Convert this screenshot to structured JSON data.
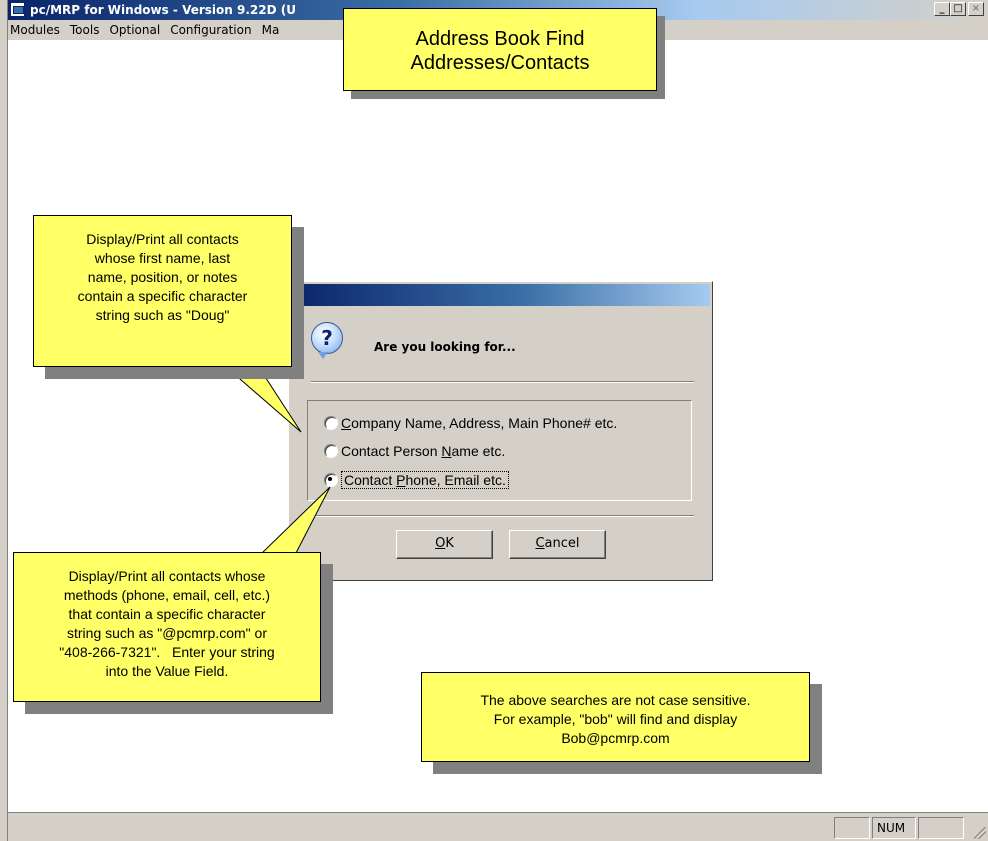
{
  "window": {
    "title": "pc/MRP for Windows - Version 9.22D (U",
    "minimize_glyph": "_",
    "maximize_glyph": "□",
    "close_glyph": "×"
  },
  "menubar": {
    "items": [
      "Modules",
      "Tools",
      "Optional",
      "Configuration",
      "Ma"
    ]
  },
  "callouts": {
    "title": [
      "Address Book Find",
      "Addresses/Contacts"
    ],
    "left": [
      "Display/Print all contacts",
      "whose first name, last",
      "name, position, or notes",
      "contain a specific character",
      "string such as \"Doug\""
    ],
    "bottom": [
      "Display/Print all contacts whose",
      "methods (phone, email, cell, etc.)",
      "that contain a specific character",
      "string such as \"@pcmrp.com\" or",
      "\"408-266-7321\".   Enter your string",
      "into the Value Field."
    ],
    "right": [
      "The above searches are not case sensitive.",
      "For example, \"bob\" will find and display",
      "Bob@pcmrp.com"
    ]
  },
  "dialog": {
    "icon_glyph": "?",
    "prompt": "Are you looking for...",
    "options": [
      {
        "pre": "",
        "key": "C",
        "post": "ompany Name, Address, Main Phone# etc.",
        "selected": false
      },
      {
        "pre": "Contact Person ",
        "key": "N",
        "post": "ame etc.",
        "selected": false
      },
      {
        "pre": "Contact ",
        "key": "P",
        "post": "hone, Email etc.",
        "selected": true
      }
    ],
    "ok": {
      "key": "O",
      "post": "K"
    },
    "cancel": {
      "key": "C",
      "post": "ancel"
    }
  },
  "statusbar": {
    "num": "NUM"
  },
  "colors": {
    "callout": "#ffff66",
    "shadow": "#808080",
    "title_active": "#0a246a",
    "face": "#d4d0c8"
  }
}
